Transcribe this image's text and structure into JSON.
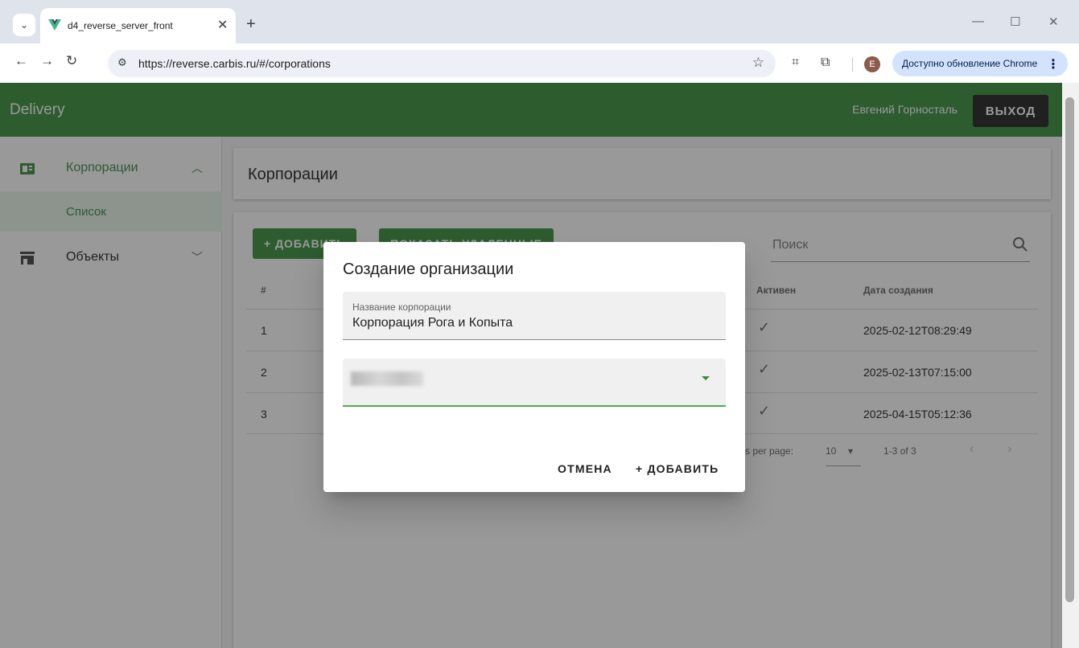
{
  "browser": {
    "tab_title": "d4_reverse_server_front",
    "tab_close": "✕",
    "new_tab": "+",
    "url": "https://reverse.carbis.ru/#/corporations",
    "update_label": "Доступно обновление Chrome",
    "profile_initial": "E"
  },
  "app": {
    "title": "Delivery",
    "user_name": "Евгений Горносталь",
    "logout_label": "выход"
  },
  "sidebar": {
    "items": [
      {
        "label": "Корпорации",
        "icon": "corporation-icon",
        "expanded": true
      },
      {
        "label": "Объекты",
        "icon": "store-icon",
        "expanded": false
      }
    ],
    "subitems": [
      {
        "label": "Список"
      }
    ]
  },
  "page": {
    "title": "Корпорации",
    "add_label": "+ ДОБАВИТЬ",
    "show_deleted_label": "ПОКАЗАТЬ УДАЛЕННЫЕ",
    "search_label": "Поиск"
  },
  "table": {
    "columns": [
      "#",
      "Активен",
      "Дата создания"
    ],
    "rows": [
      {
        "num": "1",
        "active": "✓",
        "created": "2025-02-12T08:29:49"
      },
      {
        "num": "2",
        "active": "✓",
        "created": "2025-02-13T07:15:00"
      },
      {
        "num": "3",
        "active": "✓",
        "created": "2025-04-15T05:12:36"
      }
    ],
    "rows_per_page_label": "s per page:",
    "rows_per_page": "10",
    "range": "1-3 of 3"
  },
  "dialog": {
    "title": "Создание организации",
    "name_label": "Название корпорации",
    "name_value": "Корпорация Рога и Копыта",
    "cancel_label": "ОТМЕНА",
    "add_label": "+ ДОБАВИТЬ"
  },
  "colors": {
    "primary": "#388e3c",
    "header_dark": "#212121",
    "update_pill": "#d3e3fd"
  }
}
